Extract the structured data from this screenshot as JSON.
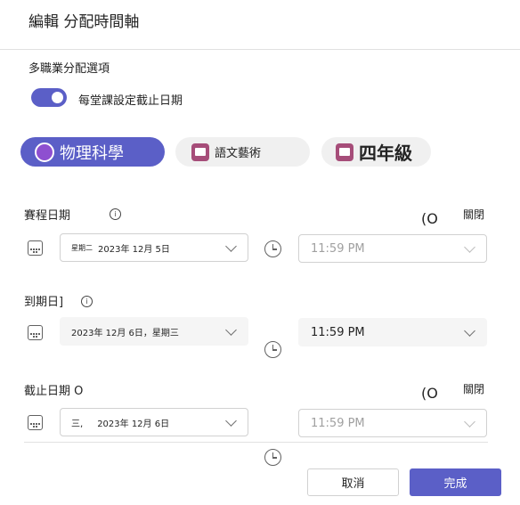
{
  "dialog": {
    "title": "編輯 分配時間軸"
  },
  "options": {
    "label": "多職業分配選項",
    "toggle_label": "每堂課設定截止日期",
    "toggle_on": true
  },
  "classes": [
    {
      "label": "物理科學",
      "icon": "physics-icon",
      "active": true
    },
    {
      "label": "語文藝術",
      "icon": "book-icon",
      "active": false
    },
    {
      "label": "四年級",
      "icon": "book-icon",
      "active": false
    }
  ],
  "schedule": {
    "label": "賽程日期",
    "info": "i",
    "paren": "(O",
    "off_label": "關閉",
    "date_prefix": "星期二",
    "date_value": "2023年 12月 5日",
    "time_value": "11:59 PM"
  },
  "due": {
    "label": "到期日]",
    "info": "i",
    "date_value": "2023年 12月 6日，星期三",
    "time_value": "11:59 PM"
  },
  "close": {
    "label": "截止日期 O",
    "paren": "(O",
    "off_label": "關閉",
    "date_prefix": "三,",
    "date_value": "2023年 12月 6日",
    "time_value": "11:59 PM"
  },
  "footer": {
    "cancel": "取消",
    "done": "完成"
  },
  "colors": {
    "accent": "#5b5fc7",
    "chip_bg": "#f0f0f0"
  }
}
